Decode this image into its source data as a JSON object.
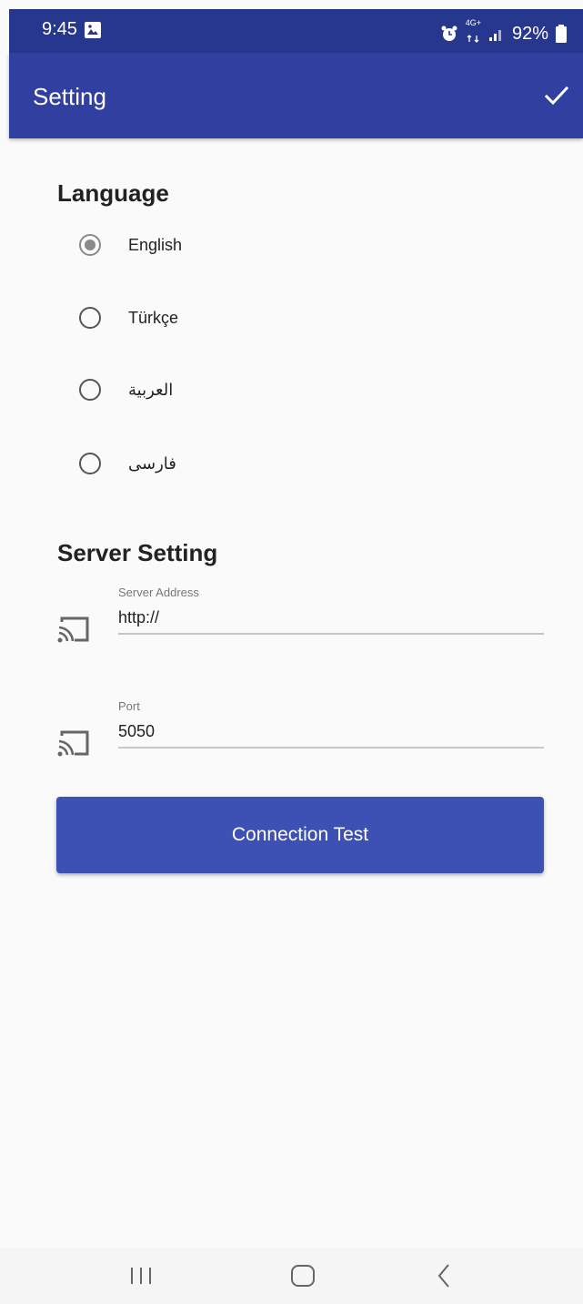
{
  "status_bar": {
    "time": "9:45",
    "battery": "92%",
    "network_label": "4G+",
    "icons": [
      "gallery-icon",
      "alarm-icon",
      "network-icon",
      "signal-icon",
      "battery-icon"
    ]
  },
  "app_bar": {
    "title": "Setting",
    "confirm_icon": "check-icon"
  },
  "language": {
    "title": "Language",
    "options": [
      {
        "label": "English",
        "selected": true
      },
      {
        "label": "Türkçe",
        "selected": false
      },
      {
        "label": "العربية",
        "selected": false
      },
      {
        "label": "فارسی",
        "selected": false
      }
    ]
  },
  "server": {
    "title": "Server Setting",
    "address": {
      "label": "Server Address",
      "value": "http://",
      "icon": "cast-icon"
    },
    "port": {
      "label": "Port",
      "value": "5050",
      "icon": "cast-icon"
    },
    "test_button": "Connection Test"
  },
  "nav_bar": {
    "icons": [
      "recent-apps-icon",
      "home-icon",
      "back-icon"
    ]
  },
  "colors": {
    "status_bar": "#28378e",
    "app_bar": "#3140a0",
    "button": "#3d50b4",
    "background": "#fafafa"
  }
}
